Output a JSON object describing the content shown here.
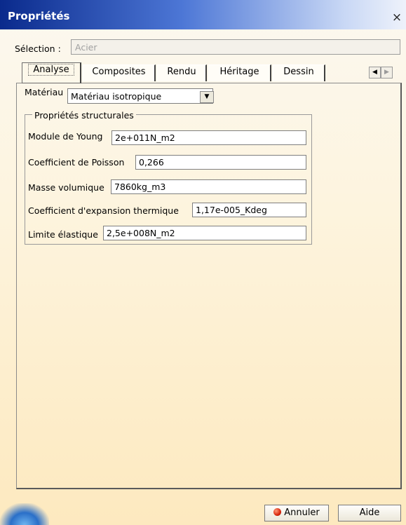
{
  "window": {
    "title": "Propriétés",
    "close_glyph": "×"
  },
  "selection": {
    "label": "Sélection :",
    "value": "Acier"
  },
  "tabs": [
    {
      "label": "Analyse",
      "active": true
    },
    {
      "label": "Composites"
    },
    {
      "label": "Rendu"
    },
    {
      "label": "Héritage"
    },
    {
      "label": "Dessin"
    }
  ],
  "tab_scroll": {
    "left_icon": "arrow-left-icon",
    "right_icon": "arrow-right-icon"
  },
  "material": {
    "label": "Matériau",
    "selected": "Matériau isotropique"
  },
  "structural": {
    "legend": "Propriétés structurales",
    "fields": [
      {
        "label": "Module de Young",
        "value": "2e+011N_m2"
      },
      {
        "label": "Coefficient de Poisson",
        "value": "0,266"
      },
      {
        "label": "Masse volumique",
        "value": "7860kg_m3"
      },
      {
        "label": "Coefficient d'expansion thermique",
        "value": "1,17e-005_Kdeg"
      },
      {
        "label": "Limite élastique",
        "value": "2,5e+008N_m2"
      }
    ]
  },
  "buttons": {
    "cancel": "Annuler",
    "help": "Aide"
  }
}
